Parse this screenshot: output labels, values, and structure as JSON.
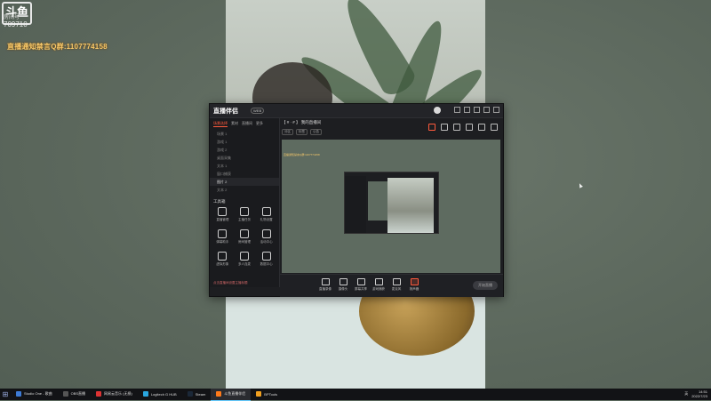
{
  "watermark": {
    "logo_text": "斗鱼",
    "logo_sub": "房间号",
    "room_number": "709710"
  },
  "notice": "直播通知禁言Q群:1107774158",
  "app": {
    "brand": "直播伴侣",
    "brand_badge": "WEB",
    "sidebar": {
      "tabs": [
        "场景选择",
        "素材",
        "直播间",
        "更多"
      ],
      "scenes": [
        "场景 1",
        "游戏 1",
        "游戏 2",
        "桌面采集",
        "文本 1",
        "窗口捕获",
        "图片 2",
        "文本 2"
      ],
      "selected_scene_index": 6,
      "tools_title": "工具箱",
      "tools": [
        "直播管理",
        "主播任务",
        "礼物设置",
        "弹幕助手",
        "房间管理",
        "活动中心",
        "虚拟形象",
        "多人连麦",
        "数据中心"
      ],
      "footer_text": "点击直播间设置主播标题"
    },
    "main": {
      "room_title": "【 # · # 】 我的直播间",
      "room_tags": [
        "分区",
        "标签",
        "公告"
      ],
      "canvas_text": "直播通知禁言Q群:1107774158",
      "bottom_buttons": [
        "直播录像",
        "摄像头",
        "屏幕共享",
        "游戏捕获",
        "麦克风",
        "扬声器"
      ],
      "live_button": "开始直播"
    }
  },
  "taskbar": {
    "items": [
      "Studio One - 歌曲",
      "OBS直播",
      "网易云音乐 (无损)",
      "Logitech G HUB",
      "Steam",
      "斗鱼直播伴侣",
      "BPTools"
    ],
    "active_index": 5,
    "tray_lang": "英",
    "clock_time": "14:51",
    "clock_date": "2022/7/23"
  }
}
